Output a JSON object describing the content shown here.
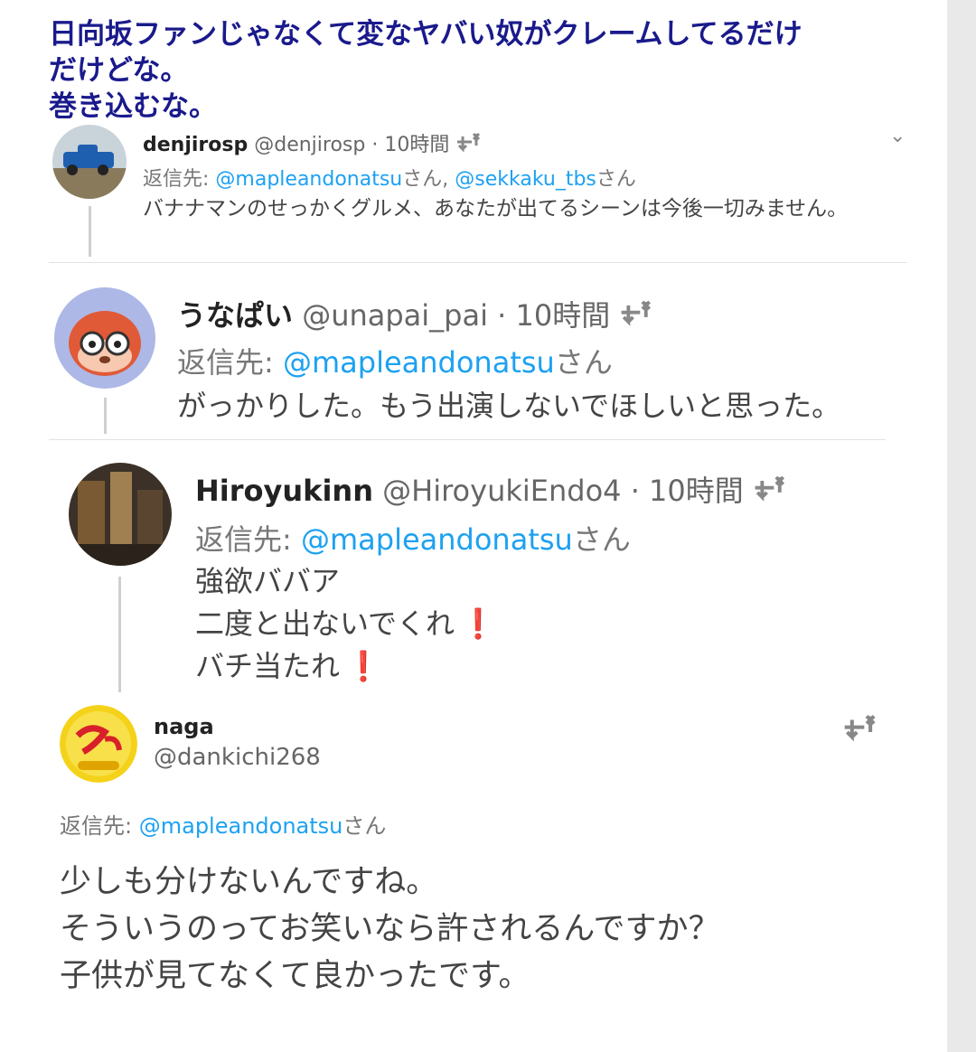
{
  "caption": {
    "line1": "日向坂ファンじゃなくて変なヤバい奴がクレームしてるだけ",
    "line2": "だけどな。",
    "line3": "巻き込むな。"
  },
  "tweets": [
    {
      "name": "denjirosp",
      "handle": "@denjirosp",
      "time": "· 10時間",
      "reply_prefix": "返信先:",
      "reply_mentions": "@mapleandonatsu",
      "reply_san1": "さん,",
      "reply_mention2": "@sekkaku_tbs",
      "reply_san2": "さん",
      "body": "バナナマンのせっかくグルメ、あなたが出てるシーンは今後一切みません。"
    },
    {
      "name": "うなぱい",
      "handle": "@unapai_pai",
      "time": "· 10時間",
      "reply_prefix": "返信先:",
      "reply_mentions": "@mapleandonatsu",
      "reply_san1": "さん",
      "body": "がっかりした。もう出演しないでほしいと思った。"
    },
    {
      "name": "Hiroyukinn",
      "handle": "@HiroyukiEndo4",
      "time": "· 10時間",
      "reply_prefix": "返信先:",
      "reply_mentions": "@mapleandonatsu",
      "reply_san1": "さん",
      "body_lines": [
        "強欲ババア",
        "二度と出ないでくれ",
        "バチ当たれ"
      ],
      "excl": "❗"
    },
    {
      "name": "naga",
      "handle": "@dankichi268",
      "reply_prefix": "返信先:",
      "reply_mentions": "@mapleandonatsu",
      "reply_san1": "さん",
      "body_lines": [
        "少しも分けないんですね。",
        "そういうのってお笑いなら許されるんですか？",
        "子供が見てなくて良かったです。"
      ]
    }
  ],
  "icons": {
    "retweet": "retweet-icon",
    "chevron": "chevron-down-icon"
  },
  "colors": {
    "caption": "#1a1a8c",
    "mention": "#1da1f2",
    "alert": "#d0021b"
  }
}
